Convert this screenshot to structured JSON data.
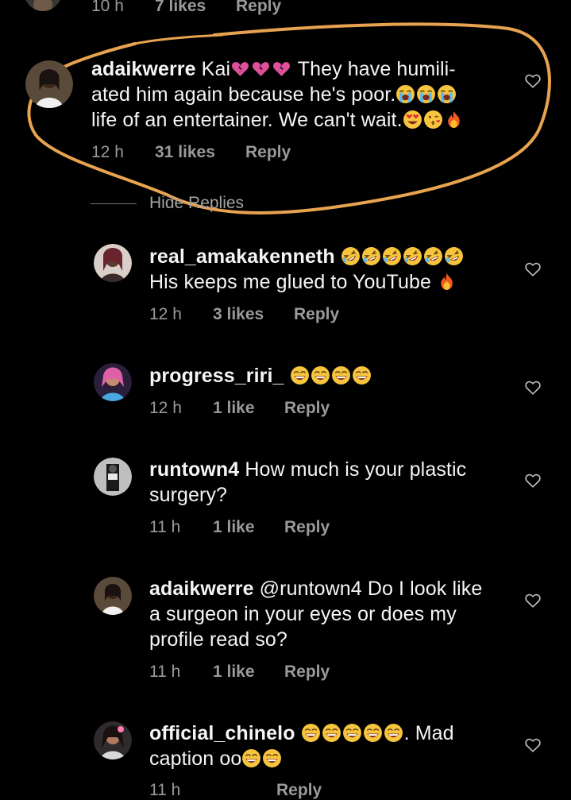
{
  "colors": {
    "background": "#000000",
    "text": "#f5f5f5",
    "meta": "#9a9a9a",
    "annotation": "#e8a350"
  },
  "hide_replies_label": "Hide Replies",
  "comments": [
    {
      "time": "10 h",
      "likes": "7 likes",
      "reply": "Reply"
    },
    {
      "username": "adaikwerre",
      "lines": [
        {
          "before": " Kai",
          "emojis": [
            "broken-heart-emoji",
            "broken-heart-emoji",
            "broken-heart-emoji"
          ],
          "after": " They have humili-"
        },
        {
          "before": "ated him again because he's poor.",
          "emojis": [
            "loudly-crying-face-emoji",
            "loudly-crying-face-emoji",
            "loudly-crying-face-emoji"
          ],
          "after": ""
        },
        {
          "before": "life of an entertainer. We can't wait.",
          "emojis": [
            "heart-eyes-emoji",
            "kissing-face-emoji",
            "fire-emoji"
          ],
          "after": ""
        }
      ],
      "time": "12 h",
      "likes": "31 likes",
      "reply": "Reply",
      "heart_icon": "heart-outline-icon"
    },
    {
      "username": "real_amakakenneth",
      "lines": [
        {
          "before": " ",
          "emojis": [
            "rolling-laughing-emoji",
            "rolling-laughing-emoji",
            "rolling-laughing-emoji",
            "rolling-laughing-emoji",
            "rolling-laughing-emoji",
            "rolling-laughing-emoji"
          ],
          "after": ""
        },
        {
          "before": "His keeps me glued to YouTube ",
          "emojis": [
            "fire-emoji"
          ],
          "after": ""
        }
      ],
      "time": "12 h",
      "likes": "3 likes",
      "reply": "Reply",
      "heart_icon": "heart-outline-icon"
    },
    {
      "username": "progress_riri_",
      "lines": [
        {
          "before": " ",
          "emojis": [
            "grinning-sweat-emoji",
            "grinning-sweat-emoji",
            "grinning-sweat-emoji",
            "grinning-sweat-emoji"
          ],
          "after": ""
        }
      ],
      "time": "12 h",
      "likes": "1 like",
      "reply": "Reply",
      "heart_icon": "heart-outline-icon"
    },
    {
      "username": "runtown4",
      "lines": [
        {
          "before": " How much is your plastic",
          "emojis": [],
          "after": ""
        },
        {
          "before": "surgery?",
          "emojis": [],
          "after": ""
        }
      ],
      "time": "11 h",
      "likes": "1 like",
      "reply": "Reply",
      "heart_icon": "heart-outline-icon"
    },
    {
      "username": "adaikwerre",
      "lines": [
        {
          "before": " @runtown4 Do I look like",
          "emojis": [],
          "after": ""
        },
        {
          "before": "a surgeon in your eyes or does my",
          "emojis": [],
          "after": ""
        },
        {
          "before": "profile read so?",
          "emojis": [],
          "after": ""
        }
      ],
      "time": "11 h",
      "likes": "1 like",
      "reply": "Reply",
      "heart_icon": "heart-outline-icon"
    },
    {
      "username": "official_chinelo",
      "lines": [
        {
          "before": " ",
          "emojis": [
            "grinning-sweat-emoji",
            "grinning-sweat-emoji",
            "grinning-sweat-emoji",
            "grinning-sweat-emoji",
            "grinning-sweat-emoji"
          ],
          "after": ". Mad"
        },
        {
          "before": "caption oo",
          "emojis": [
            "grinning-sweat-emoji",
            "grinning-sweat-emoji"
          ],
          "after": ""
        }
      ],
      "time": "11 h",
      "likes": "",
      "reply": "Reply",
      "heart_icon": "heart-outline-icon"
    }
  ]
}
